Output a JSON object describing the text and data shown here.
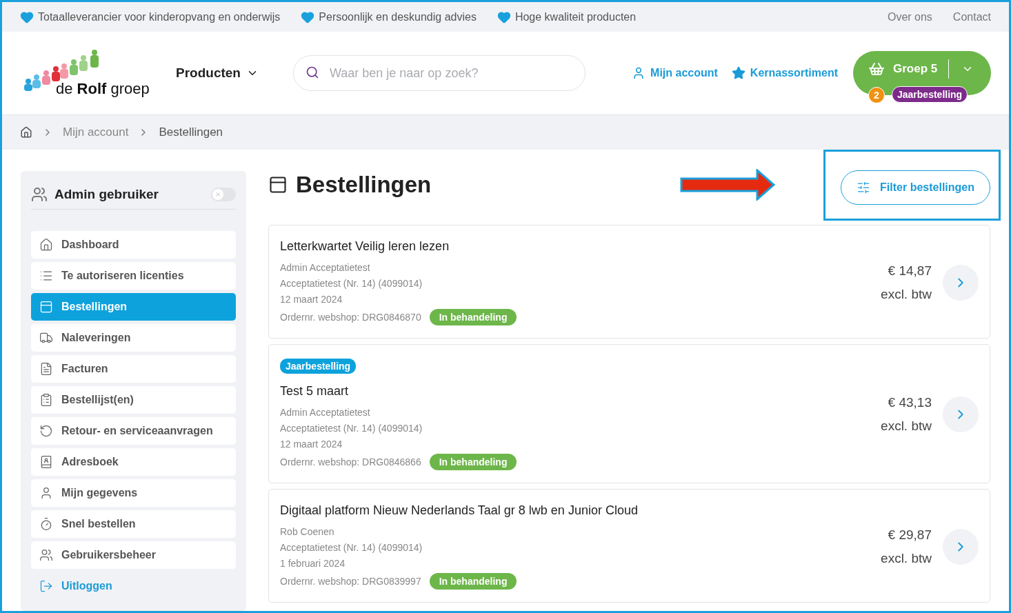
{
  "topbar": {
    "usps": [
      "Totaalleverancier voor kinderopvang en onderwijs",
      "Persoonlijk en deskundig advies",
      "Hoge kwaliteit producten"
    ],
    "links": [
      "Over ons",
      "Contact"
    ]
  },
  "header": {
    "logo": "de **Rolf** groep",
    "menu": "Producten",
    "search": {
      "placeholder": "Waar ben je naar op zoek?"
    },
    "account": "Mijn account",
    "favorites": "Kernassortiment",
    "cart": {
      "label": "Groep 5",
      "count": "2",
      "tag": "Jaarbestelling"
    }
  },
  "breadcrumb": [
    "Mijn account",
    "Bestellingen"
  ],
  "sidebar": {
    "title": "Admin gebruiker",
    "toggle_on": false,
    "items": [
      {
        "label": "Dashboard",
        "selected": false
      },
      {
        "label": "Te autoriseren licenties",
        "selected": false
      },
      {
        "label": "Bestellingen",
        "selected": true
      },
      {
        "label": "Naleveringen",
        "selected": false
      },
      {
        "label": "Facturen",
        "selected": false
      },
      {
        "label": "Bestellijst(en)",
        "selected": false
      },
      {
        "label": "Retour- en serviceaanvragen",
        "selected": false
      },
      {
        "label": "Adresboek",
        "selected": false
      },
      {
        "label": "Mijn gegevens",
        "selected": false
      },
      {
        "label": "Snel bestellen",
        "selected": false
      },
      {
        "label": "Gebruikersbeheer",
        "selected": false
      }
    ],
    "logout": "Uitloggen"
  },
  "page": {
    "title": "Bestellingen",
    "filter_button": "Filter bestellingen"
  },
  "orders": [
    {
      "title": "Letterkwartet Veilig leren lezen",
      "lines": [
        "Admin Acceptatietest",
        "Acceptatietest (Nr. 14) (4099014)",
        "12 maart 2024"
      ],
      "order_no": "Ordernr. webshop: DRG0846870",
      "status": "In behandeling",
      "price": "€ 14,87",
      "tax_note": "excl. btw"
    },
    {
      "tag": "Jaarbestelling",
      "title": "Test 5 maart",
      "lines": [
        "Admin Acceptatietest",
        "Acceptatietest (Nr. 14) (4099014)",
        "12 maart 2024"
      ],
      "order_no": "Ordernr. webshop: DRG0846866",
      "status": "In behandeling",
      "price": "€ 43,13",
      "tax_note": "excl. btw"
    },
    {
      "title": "Digitaal platform Nieuw Nederlands Taal gr 8 lwb en Junior Cloud",
      "lines": [
        "Rob Coenen",
        "Acceptatietest (Nr. 14) (4099014)",
        "1 februari 2024"
      ],
      "order_no": "Ordernr. webshop: DRG0839997",
      "status": "In behandeling",
      "price": "€ 29,87",
      "tax_note": "excl. btw"
    }
  ]
}
